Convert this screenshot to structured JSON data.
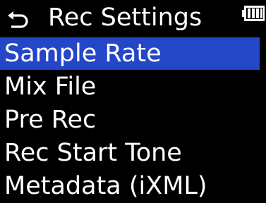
{
  "header": {
    "title": "Rec Settings",
    "back_icon": "return-arrow-icon",
    "battery_icon": "battery-icon"
  },
  "menu": {
    "selected_index": 0,
    "items": [
      {
        "label": "Sample Rate"
      },
      {
        "label": "Mix File"
      },
      {
        "label": "Pre Rec"
      },
      {
        "label": "Rec Start Tone"
      },
      {
        "label": "Metadata (iXML)"
      }
    ]
  },
  "colors": {
    "background": "#000000",
    "text": "#ffffff",
    "selection": "#2447c8"
  }
}
